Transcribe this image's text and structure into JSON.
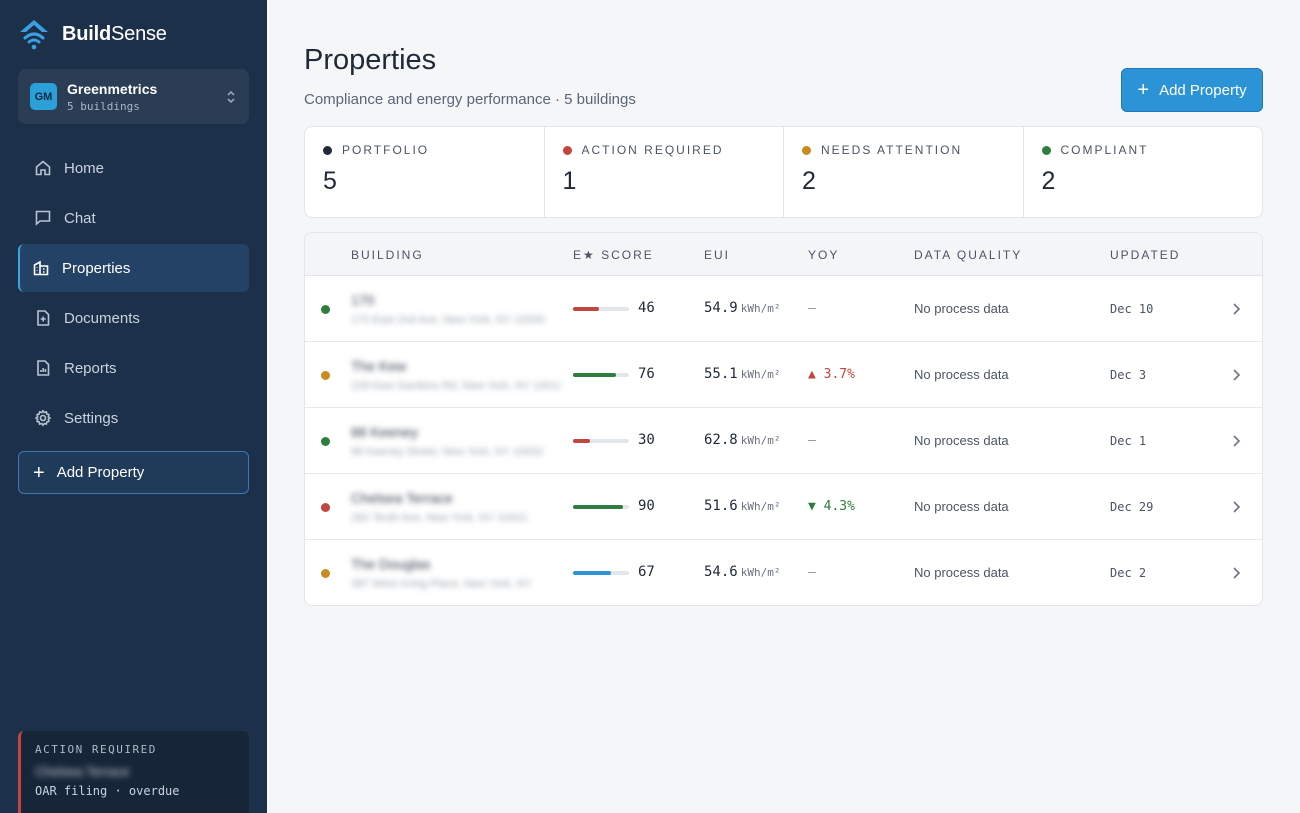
{
  "brand": {
    "name_bold": "Build",
    "name_light": "Sense"
  },
  "org": {
    "initials": "GM",
    "name": "Greenmetrics",
    "sub": "5 buildings"
  },
  "nav": [
    {
      "label": "Home",
      "icon": "home-icon",
      "active": false
    },
    {
      "label": "Chat",
      "icon": "chat-icon",
      "active": false
    },
    {
      "label": "Properties",
      "icon": "building-icon",
      "active": true
    },
    {
      "label": "Documents",
      "icon": "document-icon",
      "active": false
    },
    {
      "label": "Reports",
      "icon": "report-icon",
      "active": false
    },
    {
      "label": "Settings",
      "icon": "gear-icon",
      "active": false
    }
  ],
  "sidebar_add": "Add Property",
  "alert": {
    "label": "ACTION REQUIRED",
    "name": "Chelsea Terrace",
    "sub": "OAR filing · overdue"
  },
  "header": {
    "title": "Properties",
    "subtitle": "Compliance and energy performance · 5 buildings",
    "add_label": "Add Property"
  },
  "stats": [
    {
      "label": "PORTFOLIO",
      "value": "5",
      "color": "#1f2937"
    },
    {
      "label": "ACTION REQUIRED",
      "value": "1",
      "color": "#c4453d"
    },
    {
      "label": "NEEDS ATTENTION",
      "value": "2",
      "color": "#c98a1f"
    },
    {
      "label": "COMPLIANT",
      "value": "2",
      "color": "#2e7d3e"
    }
  ],
  "table": {
    "headers": [
      "BUILDING",
      "E★ SCORE",
      "EUI",
      "YOY",
      "DATA QUALITY",
      "UPDATED"
    ],
    "rows": [
      {
        "status_color": "#2e7d3e",
        "name": "170",
        "address": "170 East 2nd Ave, New York, NY 10009",
        "score": 46,
        "score_color": "#c4453d",
        "eui": "54.9",
        "unit": "kWh/m²",
        "yoy": "—",
        "yoy_color": "#8a94a2",
        "dq": "No process data",
        "updated": "Dec 10"
      },
      {
        "status_color": "#c98a1f",
        "name": "The Kew",
        "address": "228 Kew Gardens Rd, New York, NY 10012",
        "score": 76,
        "score_color": "#2e7d3e",
        "eui": "55.1",
        "unit": "kWh/m²",
        "yoy": "▲ 3.7%",
        "yoy_color": "#c4453d",
        "dq": "No process data",
        "updated": "Dec 3"
      },
      {
        "status_color": "#2e7d3e",
        "name": "88 Keeney",
        "address": "88 Keeney Street, New York, NY 10002",
        "score": 30,
        "score_color": "#c4453d",
        "eui": "62.8",
        "unit": "kWh/m²",
        "yoy": "—",
        "yoy_color": "#8a94a2",
        "dq": "No process data",
        "updated": "Dec 1"
      },
      {
        "status_color": "#c4453d",
        "name": "Chelsea Terrace",
        "address": "260 Tenth Ave, New York, NY 10001",
        "score": 90,
        "score_color": "#2e7d3e",
        "eui": "51.6",
        "unit": "kWh/m²",
        "yoy": "▼ 4.3%",
        "yoy_color": "#2e7d3e",
        "dq": "No process data",
        "updated": "Dec 29"
      },
      {
        "status_color": "#c98a1f",
        "name": "The Douglas",
        "address": "387 West Irving Place, New York, NY",
        "score": 67,
        "score_color": "#2e93d7",
        "eui": "54.6",
        "unit": "kWh/m²",
        "yoy": "—",
        "yoy_color": "#8a94a2",
        "dq": "No process data",
        "updated": "Dec 2"
      }
    ]
  }
}
